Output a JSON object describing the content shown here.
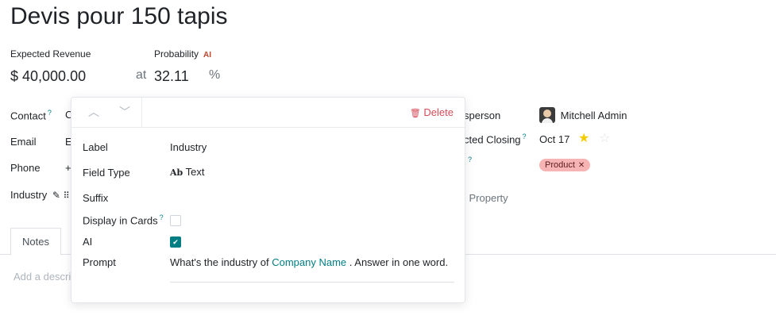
{
  "record": {
    "title": "Devis pour 150 tapis"
  },
  "revenue": {
    "label": "Expected Revenue",
    "value": "$ 40,000.00",
    "at": "at"
  },
  "probability": {
    "label": "Probability",
    "ai_badge": "AI",
    "value": "32.11",
    "unit": "%"
  },
  "left_fields": {
    "contact_label": "Contact",
    "contact_help": "?",
    "contact_value_partial": "C",
    "email_label": "Email",
    "email_value_partial": "E",
    "phone_label": "Phone",
    "phone_value_partial": "+",
    "industry_label": "Industry"
  },
  "right_fields": {
    "salesperson_label_partial": "sperson",
    "salesperson_value": "Mitchell Admin",
    "closing_label_partial": "cted Closing",
    "closing_help": "?",
    "closing_value": "Oct 17",
    "tags_help": "?",
    "tag_label": "Product",
    "tag_remove": "✕",
    "add_property_partial": "l Property"
  },
  "tabs": {
    "notes": "Notes",
    "description_placeholder_partial": "Add a descrip"
  },
  "property_popover": {
    "delete_label": "Delete",
    "label_label": "Label",
    "label_value": "Industry",
    "field_type_label": "Field Type",
    "field_type_icon": "Ab",
    "field_type_value": "Text",
    "suffix_label": "Suffix",
    "display_in_cards_label": "Display in Cards",
    "display_in_cards_help": "?",
    "display_in_cards_checked": false,
    "ai_label": "AI",
    "ai_checked": true,
    "prompt_label": "Prompt",
    "prompt_before": "What's the industry of ",
    "prompt_field": "Company Name",
    "prompt_after": " . Answer in one word."
  },
  "colors": {
    "accent": "#017e84",
    "danger": "#d44c59",
    "tag_bg": "#f6b4b4",
    "star": "#f3cc00"
  }
}
